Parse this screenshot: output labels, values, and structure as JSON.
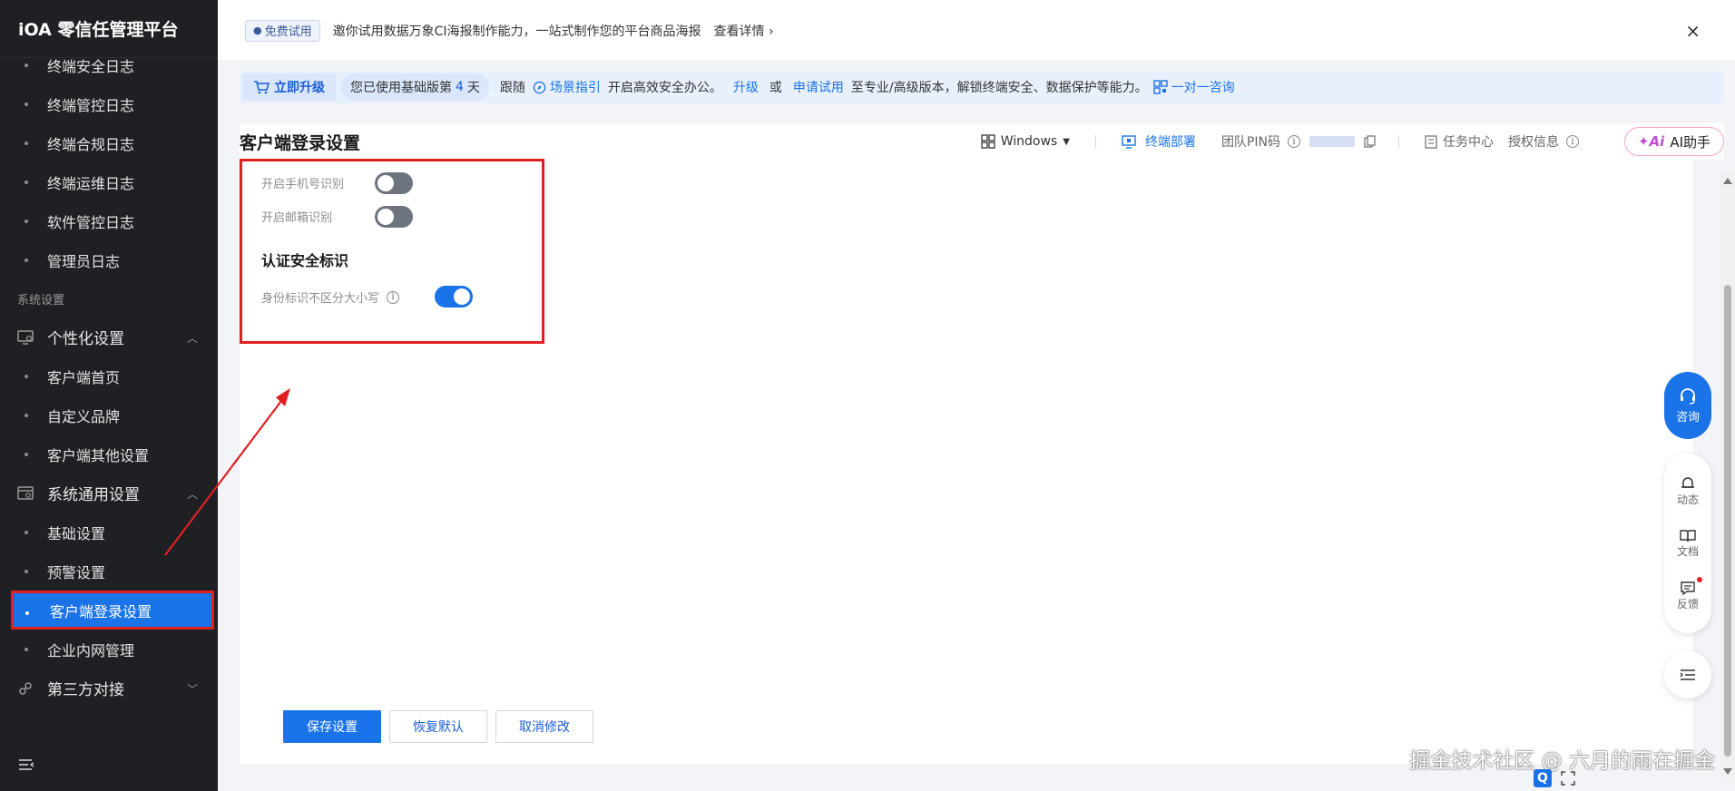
{
  "app": {
    "title": "iOA 零信任管理平台"
  },
  "sidebar": {
    "log_items": [
      "终端安全日志",
      "终端管控日志",
      "终端合规日志",
      "终端运维日志",
      "软件管控日志",
      "管理员日志"
    ],
    "section_label": "系统设置",
    "group_personalize": {
      "label": "个性化设置",
      "chev": "︿"
    },
    "personalize_items": [
      "客户端首页",
      "自定义品牌",
      "客户端其他设置"
    ],
    "group_general": {
      "label": "系统通用设置",
      "chev": "︿"
    },
    "general_items": [
      "基础设置",
      "预警设置",
      "客户端登录设置",
      "企业内网管理"
    ],
    "active_item": "客户端登录设置",
    "group_third": {
      "label": "第三方对接",
      "chev": "﹀"
    }
  },
  "notice": {
    "badge": "免费试用",
    "text": "邀你试用数据万象CI海报制作能力，一站式制作您的平台商品海报",
    "detail": "查看详情",
    "close": "×"
  },
  "upgrade": {
    "button": "立即升级",
    "used_prefix": "您已使用基础版第",
    "used_days": "4",
    "used_suffix": "天",
    "follow": "跟随",
    "guide": "场景指引",
    "guide_after": "开启高效安全办公。",
    "upgrade_link": "升级",
    "or": "或",
    "apply_link": "申请试用",
    "apply_after": "至专业/高级版本，解锁终端安全、数据保护等能力。",
    "consult_link": "一对一咨询"
  },
  "header": {
    "page_title": "客户端登录设置",
    "os": "Windows",
    "deploy": "终端部署",
    "team_pin": "团队PIN码",
    "task_center": "任务中心",
    "license": "授权信息",
    "ai": "AI助手"
  },
  "settings": {
    "phone_label": "开启手机号识别",
    "phone_on": false,
    "email_label": "开启邮箱识别",
    "email_on": false,
    "auth_section_title": "认证安全标识",
    "case_label": "身份标识不区分大小写",
    "case_on": true
  },
  "actions": {
    "save": "保存设置",
    "restore": "恢复默认",
    "cancel": "取消修改"
  },
  "float": {
    "consult": "咨询",
    "dynamic": "动态",
    "docs": "文档",
    "feedback": "反馈"
  },
  "watermark": "掘金技术社区 @ 六月的雨在掘金",
  "colors": {
    "primary": "#1a73e8",
    "sidebar_bg": "#1f2024",
    "highlight": "#e02020"
  }
}
